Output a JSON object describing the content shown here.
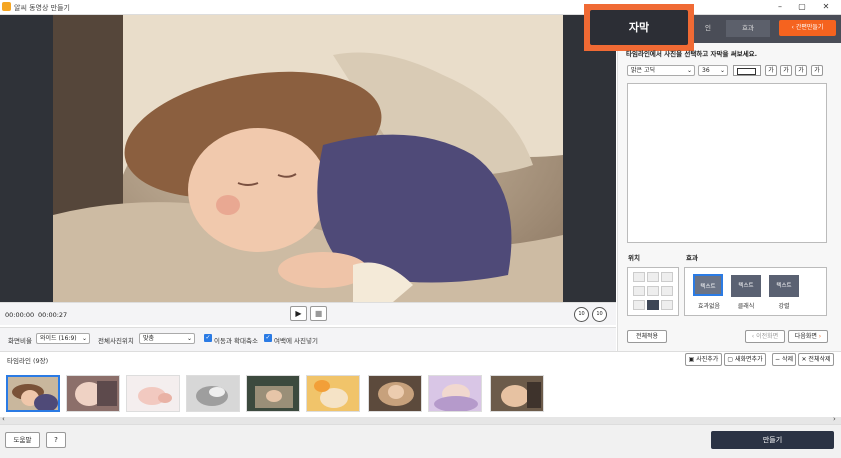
{
  "window": {
    "title": "알씨 동영상 만들기",
    "controls": [
      "–",
      "▢",
      "✕"
    ]
  },
  "player": {
    "time_current": "00:00:00",
    "time_total": "00:00:27",
    "play_icon": "play-icon",
    "stop_icon": "stop-icon",
    "rewind_label": "10",
    "forward_label": "10"
  },
  "options": {
    "ratio_label": "화면비율",
    "ratio_value": "와이드 (16:9)",
    "photo_pos_label": "전체사진위치",
    "photo_pos_value": "맞춤",
    "move_zoom_label": "이동과 확대축소",
    "fill_blank_label": "여백에 사진넣기"
  },
  "panel": {
    "tabs": [
      "자막",
      "인",
      "효과"
    ],
    "active_tab": "자막",
    "easy_make_label": "간편만들기",
    "instruction": "타임라인에서 사진을 선택하고 자막을 써보세요.",
    "font_value": "맑은 고딕",
    "size_value": "36",
    "style_buttons": [
      "가",
      "가",
      "가",
      "가"
    ],
    "position_label": "위치",
    "effect_label": "효과",
    "effects": [
      {
        "thumb": "텍스트",
        "label": "효과없음"
      },
      {
        "thumb": "텍스트",
        "label": "클래식"
      },
      {
        "thumb": "텍스트",
        "label": "강렬"
      }
    ],
    "apply_all_label": "전체적용",
    "prev_label": "이전화면",
    "next_label": "다음화면"
  },
  "timeline": {
    "title": "타임라인 (9장)",
    "buttons": [
      "사진추가",
      "새화면추가",
      "삭제",
      "전체삭제"
    ],
    "count": 9
  },
  "bottom": {
    "help_label": "도움말",
    "question_label": "?",
    "make_label": "만들기"
  },
  "colors": {
    "accent_orange": "#f5631f",
    "callout_orange": "#f06a34",
    "dark_tab": "#4a4d57",
    "make_button": "#2b3344"
  }
}
